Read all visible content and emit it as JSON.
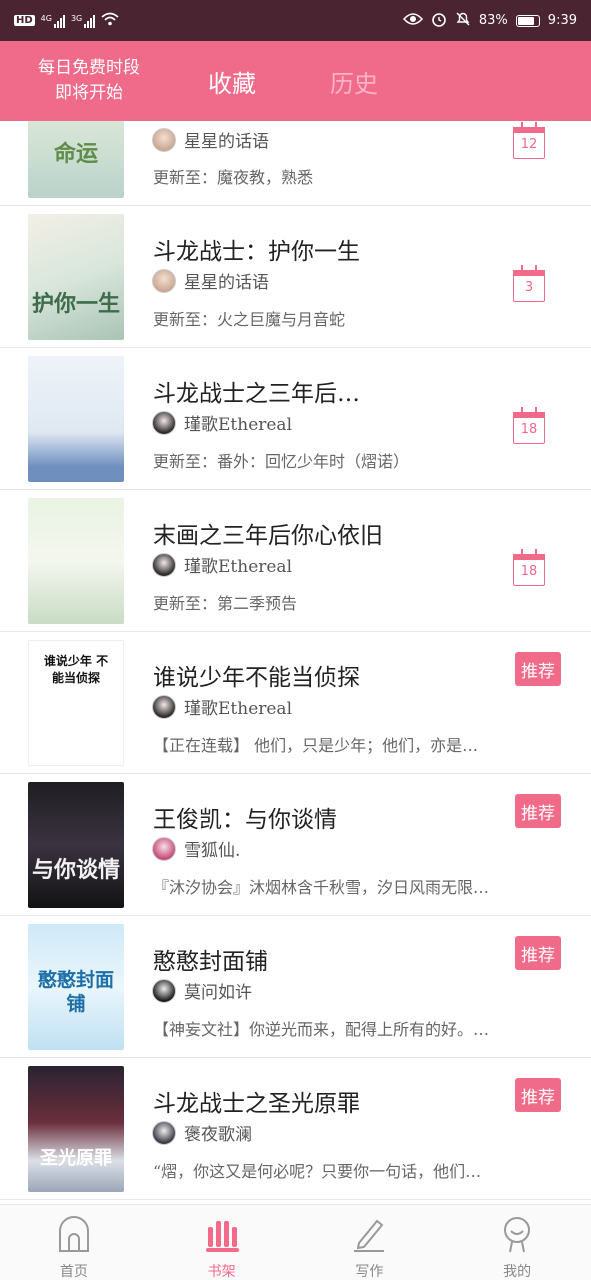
{
  "status_bar": {
    "badge": "HD",
    "net1": "4G",
    "net2": "3G",
    "battery_percent": "83%",
    "time": "9:39"
  },
  "header": {
    "free_slot_line1": "每日免费时段",
    "free_slot_line2": "即将开始",
    "tabs": [
      {
        "label": "收藏",
        "active": true
      },
      {
        "label": "历史",
        "active": false
      }
    ]
  },
  "books": [
    {
      "title": "",
      "cover_text": "命运",
      "author": "星星的话语",
      "update": "更新至：魔夜教，熟悉",
      "calendar_day": "12",
      "recommend": ""
    },
    {
      "title": "斗龙战士：护你一生",
      "cover_text": "护你一生",
      "author": "星星的话语",
      "update": "更新至：火之巨魔与月音蛇",
      "calendar_day": "3",
      "recommend": ""
    },
    {
      "title": "斗龙战士之三年后…",
      "cover_text": "",
      "author": "瑾歌Ethereal",
      "update": "更新至：番外：回忆少年时（熠诺）",
      "calendar_day": "18",
      "recommend": ""
    },
    {
      "title": "末画之三年后你心依旧",
      "cover_text": "",
      "author": "瑾歌Ethereal",
      "update": "更新至：第二季预告",
      "calendar_day": "18",
      "recommend": ""
    },
    {
      "title": "谁说少年不能当侦探",
      "cover_text": "谁说少年 不能当侦探",
      "author": "瑾歌Ethereal",
      "update": "【正在连载】 他们，只是少年；他们，亦是…",
      "calendar_day": "",
      "recommend": "推荐"
    },
    {
      "title": "王俊凯：与你谈情",
      "cover_text": "与你谈情",
      "author": "雪狐仙.",
      "update": "『沐汐协会』沐烟林含千秋雪，汐日风雨无限…",
      "calendar_day": "",
      "recommend": "推荐"
    },
    {
      "title": "憨憨封面铺",
      "cover_text": "憨憨封面铺",
      "author": "莫问如许",
      "update": "【神妄文社】你逆光而来，配得上所有的好。…",
      "calendar_day": "",
      "recommend": "推荐"
    },
    {
      "title": "斗龙战士之圣光原罪",
      "cover_text": "圣光原罪",
      "author": "褒夜歌澜",
      "update": "“熠，你这又是何必呢？只要你一句话，他们…",
      "calendar_day": "",
      "recommend": "推荐"
    }
  ],
  "bottom_nav": [
    {
      "label": "首页",
      "active": false
    },
    {
      "label": "书架",
      "active": true
    },
    {
      "label": "写作",
      "active": false
    },
    {
      "label": "我的",
      "active": false
    }
  ],
  "colors": {
    "accent": "#f06a8a",
    "status_bar": "#4a2430",
    "inactive_tab": "#f9b4c5"
  },
  "icons": [
    "hd-icon",
    "signal-icon",
    "wifi-icon",
    "eye-icon",
    "alarm-icon",
    "mute-icon",
    "battery-icon",
    "calendar-icon",
    "home-icon",
    "bookshelf-icon",
    "pencil-icon",
    "profile-icon"
  ]
}
